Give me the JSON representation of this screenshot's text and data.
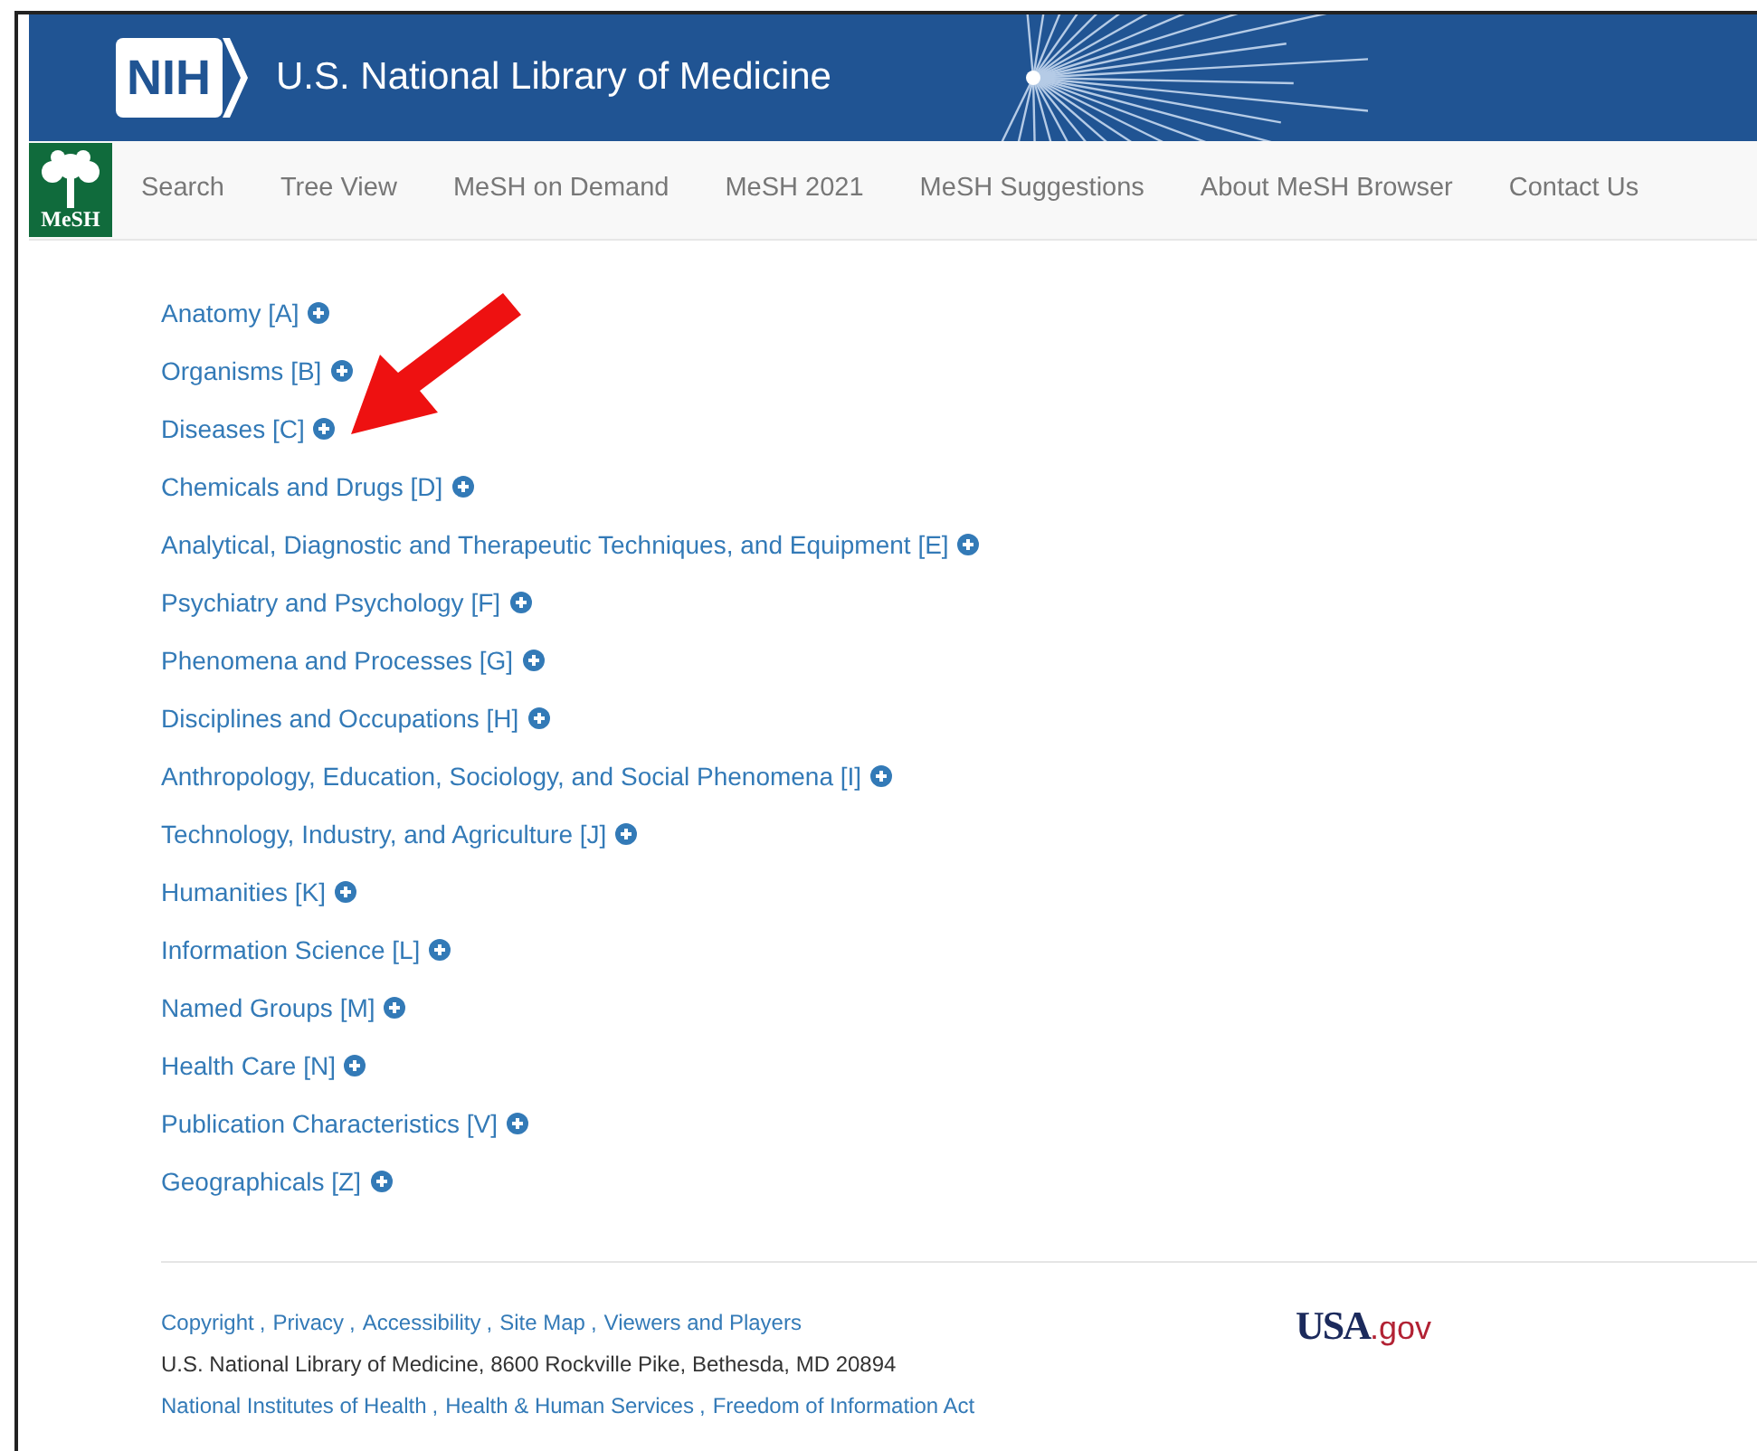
{
  "header": {
    "logo_text": "NIH",
    "title": "U.S. National Library of Medicine"
  },
  "nav": {
    "logo_text": "MeSH",
    "items": [
      {
        "label": "Search"
      },
      {
        "label": "Tree View"
      },
      {
        "label": "MeSH on Demand"
      },
      {
        "label": "MeSH 2021"
      },
      {
        "label": "MeSH Suggestions"
      },
      {
        "label": "About MeSH Browser"
      },
      {
        "label": "Contact Us"
      }
    ]
  },
  "tree": [
    {
      "label": "Anatomy [A]"
    },
    {
      "label": "Organisms [B]"
    },
    {
      "label": "Diseases [C]"
    },
    {
      "label": "Chemicals and Drugs [D]"
    },
    {
      "label": "Analytical, Diagnostic and Therapeutic Techniques, and Equipment [E]"
    },
    {
      "label": "Psychiatry and Psychology [F]"
    },
    {
      "label": "Phenomena and Processes [G]"
    },
    {
      "label": "Disciplines and Occupations [H]"
    },
    {
      "label": "Anthropology, Education, Sociology, and Social Phenomena [I]"
    },
    {
      "label": "Technology, Industry, and Agriculture [J]"
    },
    {
      "label": "Humanities [K]"
    },
    {
      "label": "Information Science [L]"
    },
    {
      "label": "Named Groups [M]"
    },
    {
      "label": "Health Care [N]"
    },
    {
      "label": "Publication Characteristics [V]"
    },
    {
      "label": "Geographicals [Z]"
    }
  ],
  "footer": {
    "links_row": [
      {
        "label": "Copyright",
        "sep": ","
      },
      {
        "label": "Privacy",
        "sep": ","
      },
      {
        "label": "Accessibility",
        "sep": ","
      },
      {
        "label": "Site Map",
        "sep": ","
      },
      {
        "label": "Viewers and Players"
      }
    ],
    "address": "U.S. National Library of Medicine, 8600 Rockville Pike, Bethesda, MD 20894",
    "agency_row": [
      {
        "label": "National Institutes of Health",
        "sep": ","
      },
      {
        "label": "Health & Human Services",
        "sep": ","
      },
      {
        "label": "Freedom of Information Act"
      }
    ],
    "usa_logo": {
      "main": "USA",
      "suffix": ".gov"
    }
  }
}
